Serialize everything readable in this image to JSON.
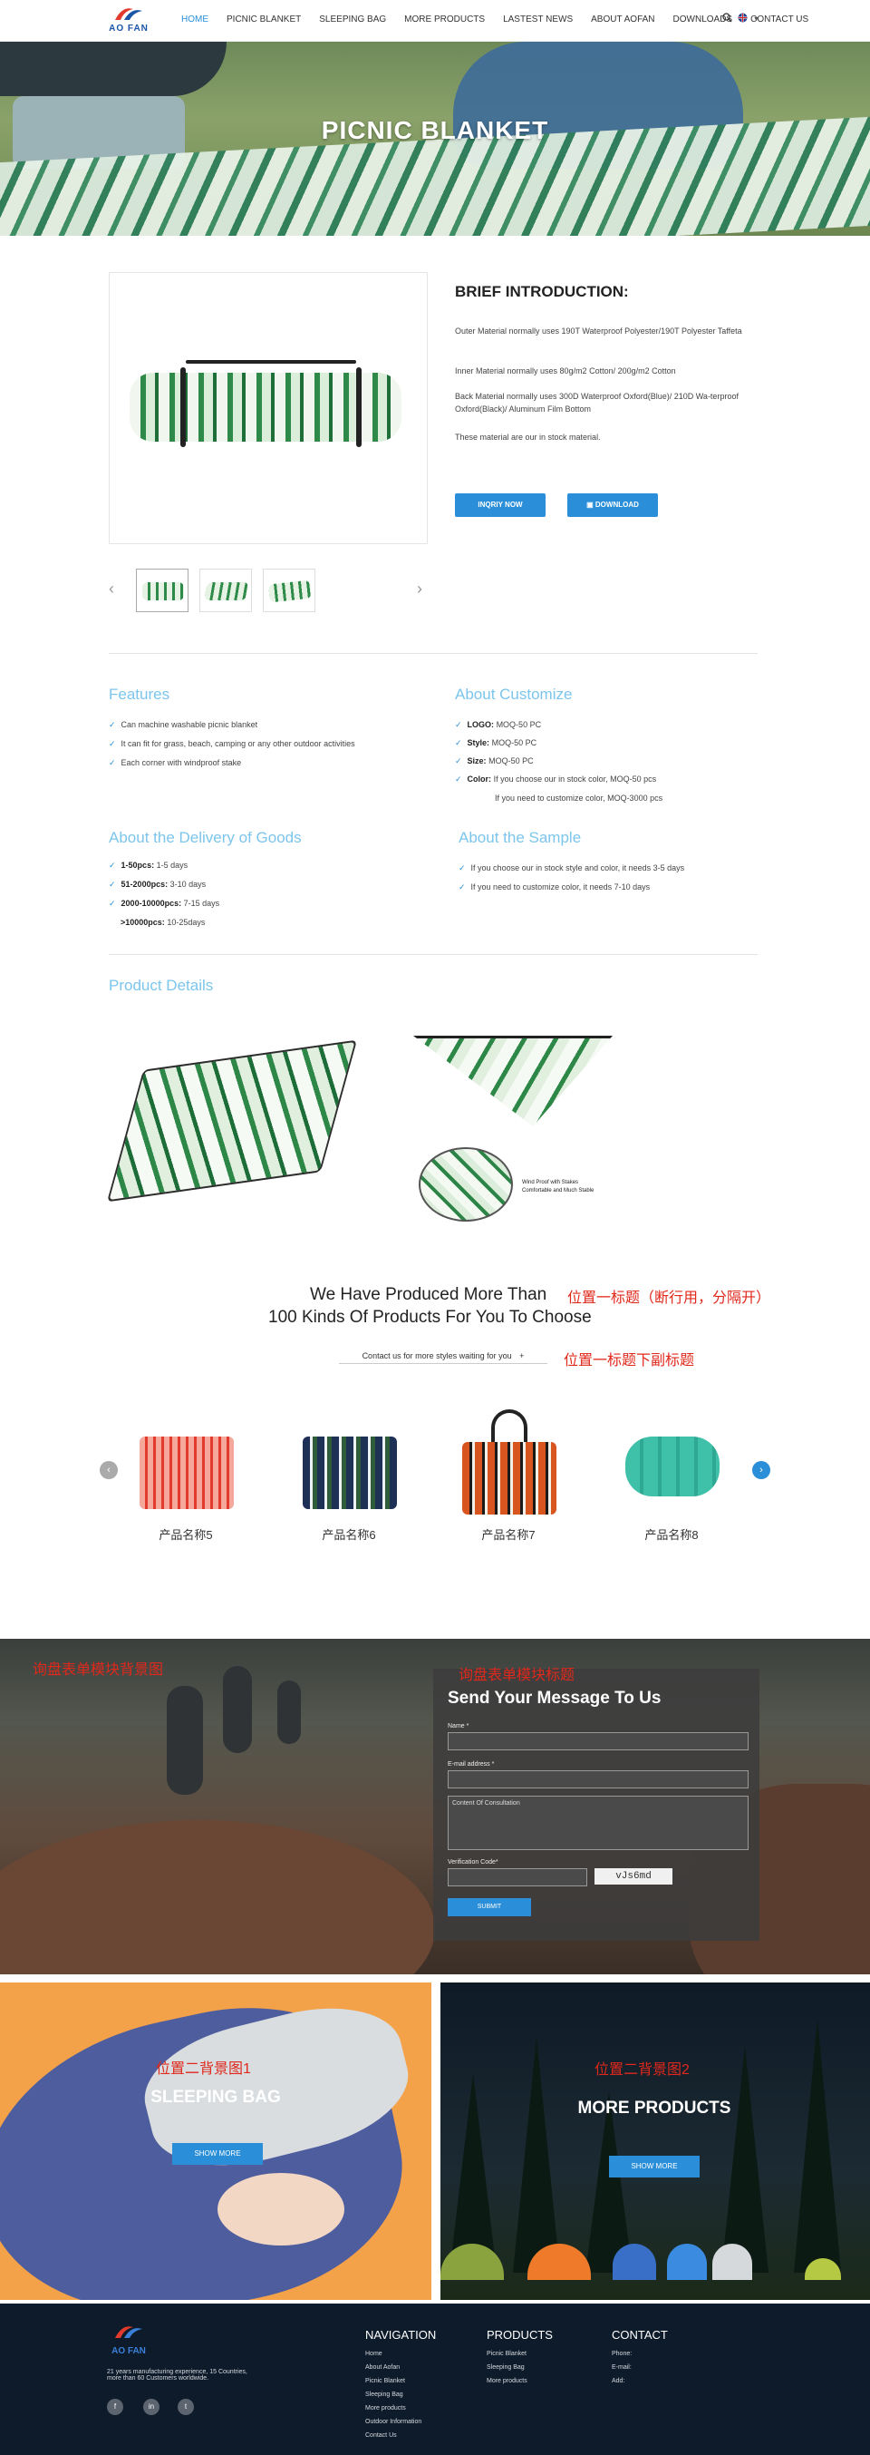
{
  "header": {
    "logo_text": "AO FAN",
    "nav": [
      "HOME",
      "PICNIC BLANKET",
      "SLEEPING BAG",
      "MORE PRODUCTS",
      "LASTEST NEWS",
      "ABOUT AOFAN",
      "DOWNLOADS",
      "CONTACT US"
    ],
    "active_index": 0
  },
  "hero": {
    "title": "PICNIC BLANKET"
  },
  "product": {
    "brief_title": "BRIEF INTRODUCTION:",
    "paragraphs": [
      "Outer Material normally uses 190T Waterproof Polyester/190T Polyester Taffeta",
      "Inner Material normally uses 80g/m2 Cotton/ 200g/m2 Cotton",
      "Back Material normally uses 300D Waterproof Oxford(Blue)/ 210D Wa-terproof Oxford(Black)/ Aluminum Film Bottom",
      "These material are our in stock material."
    ],
    "inquiry_button": "INQRIY NOW",
    "download_button": "DOWNLOAD"
  },
  "features": {
    "title": "Features",
    "items": [
      "Can machine washable picnic blanket",
      "It can fit for grass, beach, camping or any other outdoor activities",
      "Each corner with windproof stake"
    ]
  },
  "customize": {
    "title": "About Customize",
    "items": [
      {
        "label": "LOGO:",
        "value": "MOQ-50 PC"
      },
      {
        "label": "Style:",
        "value": "MOQ-50 PC"
      },
      {
        "label": "Size:",
        "value": "MOQ-50 PC"
      },
      {
        "label": "Color:",
        "value": "If you choose our in stock color, MOQ-50 pcs"
      }
    ],
    "extra": "If you need to customize color, MOQ-3000 pcs"
  },
  "delivery": {
    "title": "About the Delivery of Goods",
    "items": [
      {
        "label": "1-50pcs:",
        "value": "1-5 days"
      },
      {
        "label": "51-2000pcs:",
        "value": "3-10 days"
      },
      {
        "label": "2000-10000pcs:",
        "value": "7-15 days"
      }
    ],
    "extra": {
      "label": ">10000pcs:",
      "value": "10-25days"
    }
  },
  "sample": {
    "title": "About the Sample",
    "items": [
      "If you choose our in stock style and color, it needs 3-5 days",
      "If you need to customize color, it needs 7-10 days"
    ]
  },
  "details": {
    "title": "Product Details",
    "caption_line1": "Wind Proof with Stakes",
    "caption_line2": "Comfortable and Much Stable"
  },
  "produced": {
    "title_line1": "We Have Produced More Than",
    "title_line2": "100 Kinds Of Products For You To Choose",
    "title_note": "位置一标题（断行用，分隔开）",
    "subtitle": "Contact us for more styles waiting for you",
    "subtitle_icon": "+",
    "subtitle_note": "位置一标题下副标题",
    "products": [
      "产品名称5",
      "产品名称6",
      "产品名称7",
      "产品名称8"
    ]
  },
  "message": {
    "bg_note": "询盘表单模块背景图",
    "title_note": "询盘表单模块标题",
    "title": "Send Your Message To Us",
    "name_label": "Name *",
    "email_label": "E-mail address *",
    "content_placeholder": "Content Of Consultation",
    "code_label": "Verification Code*",
    "captcha": "vJs6md",
    "submit": "SUBMIT"
  },
  "promos": [
    {
      "note": "位置二背景图1",
      "title": "SLEEPING BAG",
      "button": "SHOW MORE"
    },
    {
      "note": "位置二背景图2",
      "title": "MORE PRODUCTS",
      "button": "SHOW MORE"
    }
  ],
  "footer": {
    "logo_text": "AO FAN",
    "about_line1": "21 years manufacturing experience, 15 Countries,",
    "about_line2": "more than 60 Customers worldwide.",
    "navigation_title": "NAVIGATION",
    "navigation": [
      "Home",
      "About Aofan",
      "Picnic Blanket",
      "Sleeping Bag",
      "More products",
      "Outdoor Information",
      "Contact Us"
    ],
    "products_title": "PRODUCTS",
    "products": [
      "Picnic Blanket",
      "Sleeping Bag",
      "More products"
    ],
    "contact_title": "CONTACT",
    "contact": [
      "Phone:",
      "E-mail:",
      "Add:"
    ],
    "social": [
      "f",
      "in",
      "t"
    ]
  },
  "colors": {
    "accent": "#2a8fd8",
    "section_title": "#7cc5ec",
    "note_red": "#e0281b",
    "footer_bg": "#0e1b2b"
  }
}
